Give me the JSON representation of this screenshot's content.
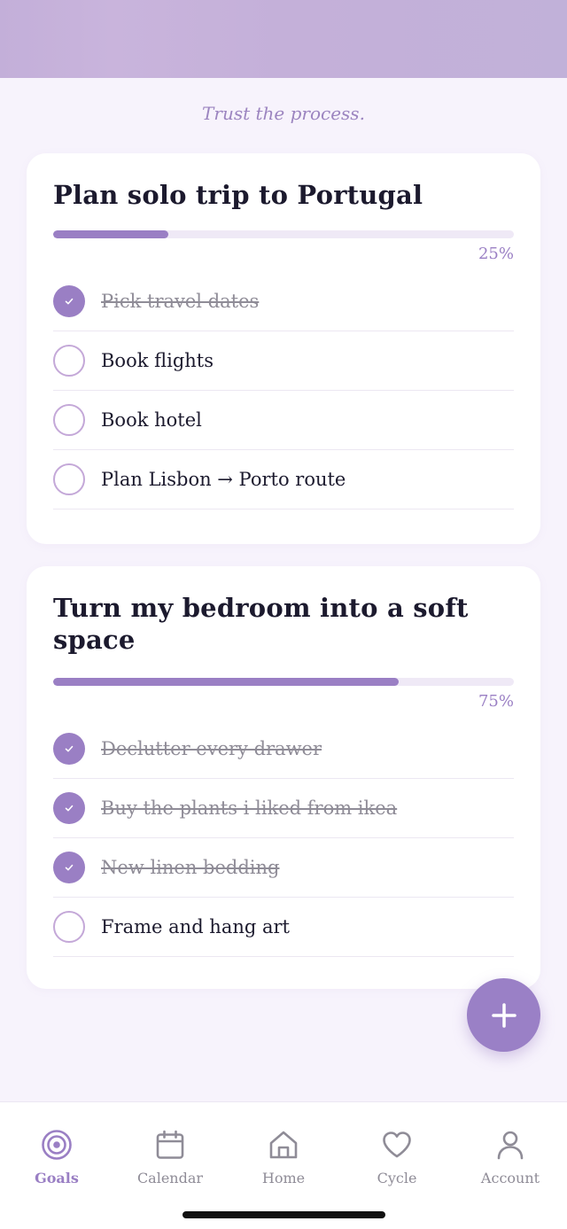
{
  "quote": "Trust the process.",
  "goals": [
    {
      "title": "Plan solo trip to Portugal",
      "progress_percent": 25,
      "percent_label": "25%",
      "tasks": [
        {
          "label": "Pick travel dates",
          "done": true
        },
        {
          "label": "Book flights",
          "done": false
        },
        {
          "label": "Book hotel",
          "done": false
        },
        {
          "label": "Plan Lisbon → Porto route",
          "done": false
        }
      ]
    },
    {
      "title": "Turn my bedroom into a soft space",
      "progress_percent": 75,
      "percent_label": "75%",
      "tasks": [
        {
          "label": "Declutter every drawer",
          "done": true
        },
        {
          "label": "Buy the plants i liked from ikea",
          "done": true
        },
        {
          "label": "New linen bedding",
          "done": true
        },
        {
          "label": "Frame and hang art",
          "done": false
        }
      ]
    }
  ],
  "fab": {
    "icon": "plus-icon"
  },
  "tabs": [
    {
      "label": "Goals",
      "icon": "target-icon",
      "active": true
    },
    {
      "label": "Calendar",
      "icon": "calendar-icon",
      "active": false
    },
    {
      "label": "Home",
      "icon": "home-icon",
      "active": false
    },
    {
      "label": "Cycle",
      "icon": "heart-icon",
      "active": false
    },
    {
      "label": "Account",
      "icon": "person-icon",
      "active": false
    }
  ],
  "colors": {
    "accent": "#9a7fc4",
    "open_checkbox_border": "#c4a8d8",
    "background": "#f7f3fc",
    "text": "#1c1a2e",
    "muted": "#8f8c97"
  }
}
